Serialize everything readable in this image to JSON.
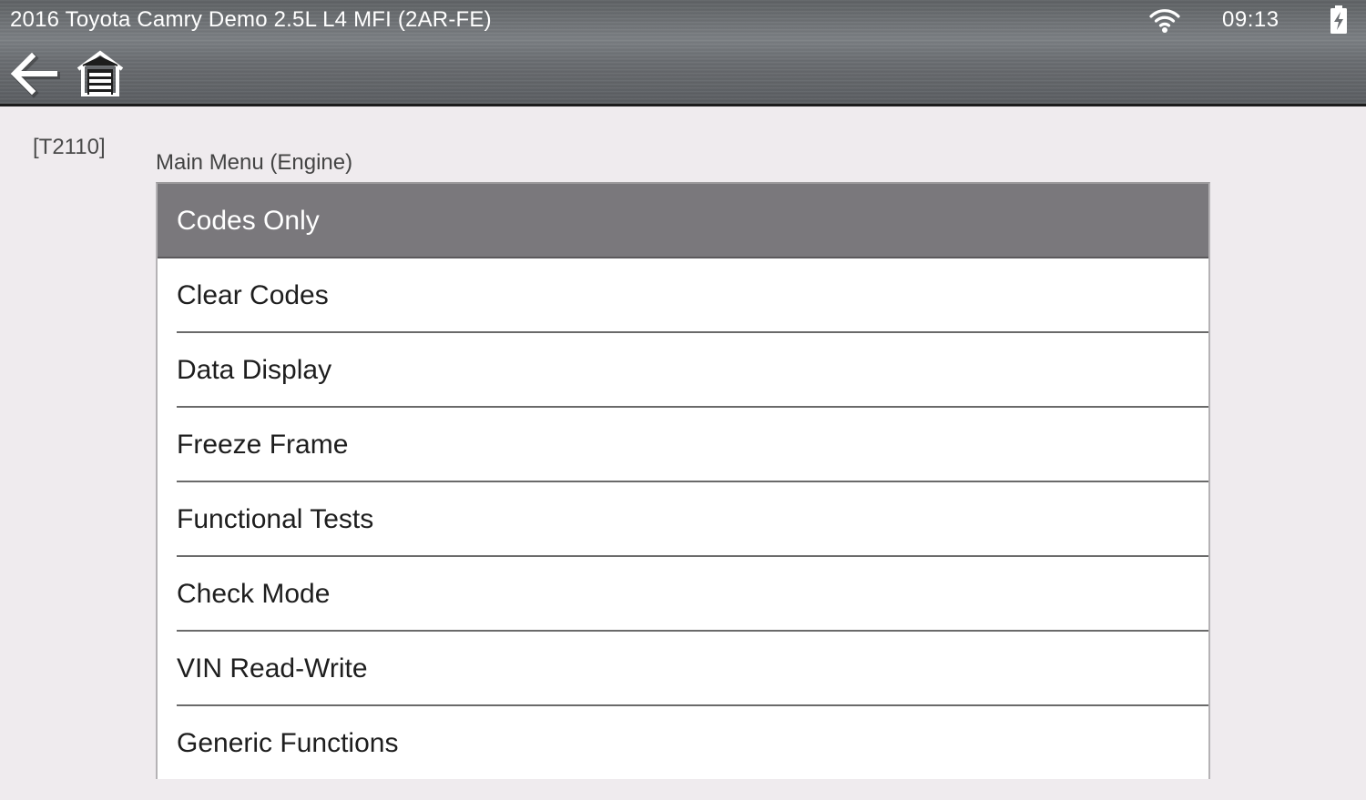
{
  "header": {
    "vehicle_title": "2016 Toyota Camry Demo 2.5L L4 MFI (2AR-FE)",
    "time": "09:13",
    "icons": {
      "wifi": "wifi-icon",
      "battery": "battery-charging-icon",
      "back": "back-arrow-icon",
      "home": "home-garage-icon"
    }
  },
  "screen_code": "[T2110]",
  "menu": {
    "title": "Main Menu (Engine)",
    "selected_index": 0,
    "items": [
      {
        "label": "Codes Only"
      },
      {
        "label": "Clear Codes"
      },
      {
        "label": "Data Display"
      },
      {
        "label": "Freeze Frame"
      },
      {
        "label": "Functional Tests"
      },
      {
        "label": "Check Mode"
      },
      {
        "label": "VIN Read-Write"
      },
      {
        "label": "Generic Functions"
      }
    ]
  },
  "colors": {
    "selected_row": "#7a787c",
    "background": "#efebee",
    "header": "#6b6e72"
  }
}
